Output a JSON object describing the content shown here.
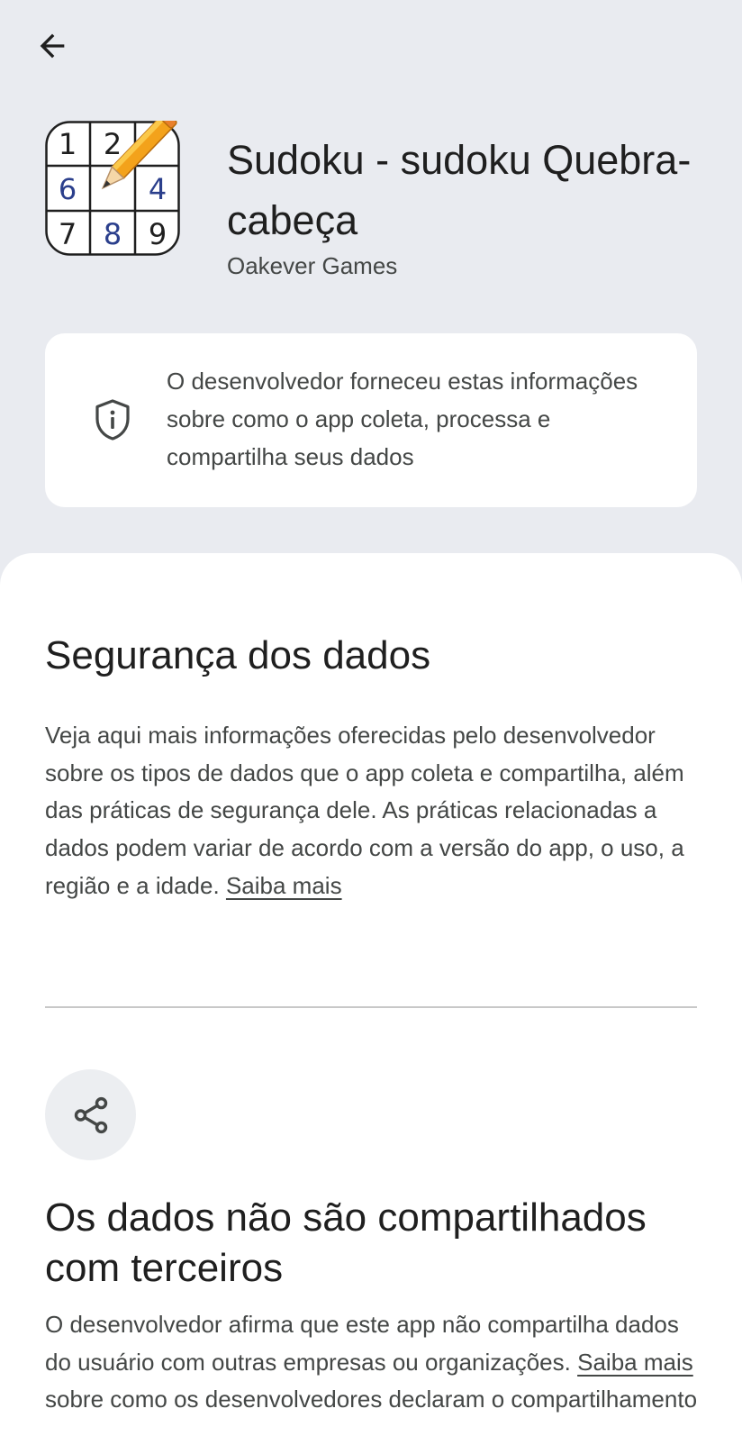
{
  "nav": {
    "back_icon": "arrow-left-icon"
  },
  "app": {
    "title": "Sudoku - sudoku Quebra-cabeça",
    "developer": "Oakever Games",
    "icon_digits": [
      "1",
      "2",
      "6",
      "4",
      "7",
      "8",
      "9"
    ],
    "icon_name": "sudoku-pencil-icon"
  },
  "info_card": {
    "icon": "shield-info-icon",
    "text": "O desenvolvedor forneceu estas informações sobre como o app coleta, processa e compartilha seus dados"
  },
  "data_safety": {
    "title": "Segurança dos dados",
    "body": "Veja aqui mais informações oferecidas pelo desenvolvedor sobre os tipos de dados que o app coleta e compartilha, além das práticas de segurança dele. As práticas relacionadas a dados podem variar de acordo com a versão do app, o uso, a região e a idade.",
    "link": "Saiba mais"
  },
  "sharing": {
    "icon": "share-icon",
    "title": "Os dados não são compartilhados com terceiros",
    "body_before": "O desenvolvedor afirma que este app não compartilha dados do usuário com outras empresas ou organizações.",
    "link": "Saiba mais",
    "body_after": "sobre como os desenvolvedores declaram o compartilhamento"
  },
  "colors": {
    "background": "#e9ebf0",
    "card": "#ffffff",
    "text_primary": "#1f1f1f",
    "text_secondary": "#444746",
    "icon_digit_blue": "#2b3f8c"
  }
}
